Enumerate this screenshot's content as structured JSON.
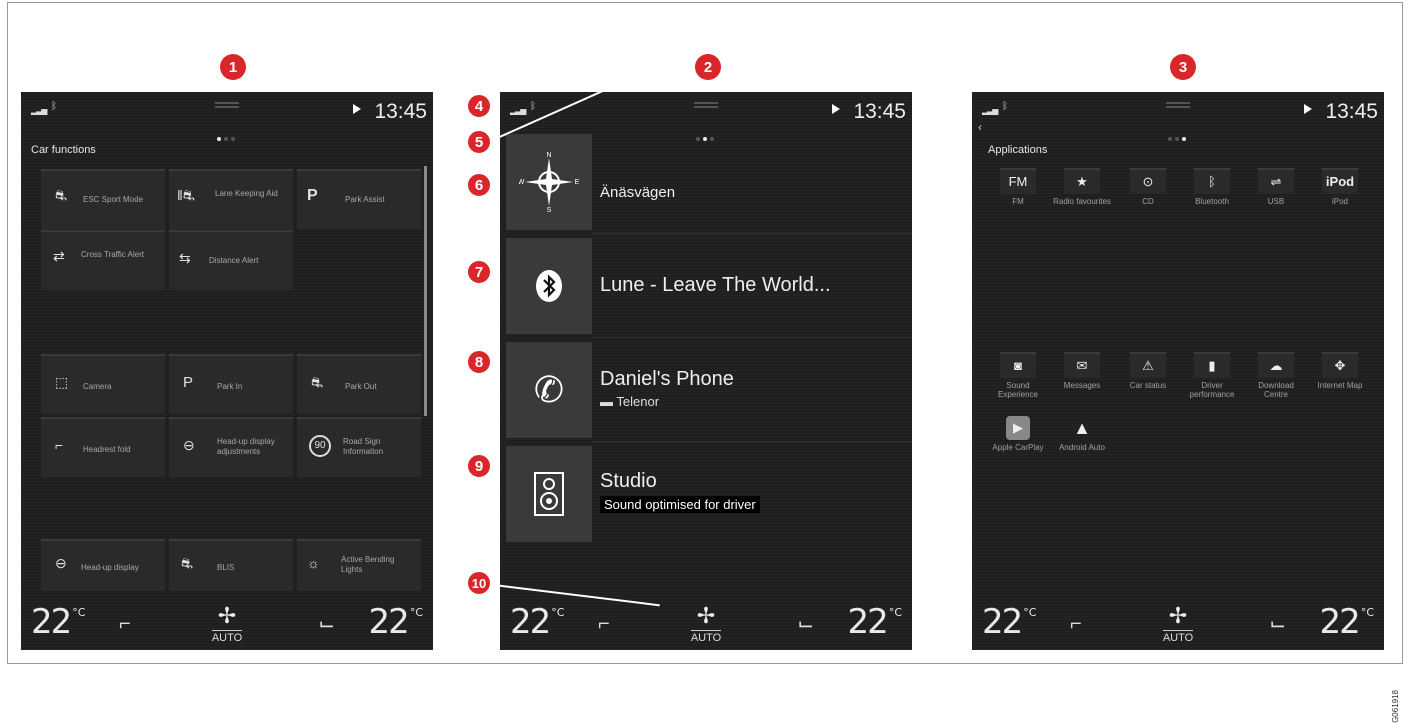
{
  "badges": [
    "1",
    "2",
    "3",
    "4",
    "5",
    "6",
    "7",
    "8",
    "9",
    "10"
  ],
  "screen_status": {
    "clock": "13:45"
  },
  "car_functions": {
    "title": "Car functions",
    "tiles": [
      {
        "icon": "esc-icon",
        "label": "ESC Sport Mode"
      },
      {
        "icon": "lane-keeping-icon",
        "label": "Lane Keeping Aid"
      },
      {
        "icon": "park-assist-icon",
        "label": "Park Assist"
      },
      {
        "icon": "cross-traffic-icon",
        "label": "Cross Traffic Alert"
      },
      {
        "icon": "distance-alert-icon",
        "label": "Distance Alert"
      },
      {
        "icon": "camera-icon",
        "label": "Camera"
      },
      {
        "icon": "park-in-icon",
        "label": "Park In"
      },
      {
        "icon": "park-out-icon",
        "label": "Park Out"
      },
      {
        "icon": "headrest-fold-icon",
        "label": "Headrest fold"
      },
      {
        "icon": "head-up-adjust-icon",
        "label": "Head-up display adjustments"
      },
      {
        "icon": "road-sign-icon",
        "label": "Road Sign Information"
      },
      {
        "icon": "head-up-display-icon",
        "label": "Head-up display"
      },
      {
        "icon": "blis-icon",
        "label": "BLIS"
      },
      {
        "icon": "bending-lights-icon",
        "label": "Active Bending Lights"
      }
    ],
    "glyphs": {
      "park": "P",
      "parkin": "P",
      "road_sign": "90"
    }
  },
  "home": {
    "nav": {
      "icon": "compass-icon",
      "compass": [
        "N",
        "E",
        "S",
        "W"
      ],
      "text": "Änäsvägen"
    },
    "media": {
      "icon": "bluetooth-icon",
      "text": "Lune - Leave The World..."
    },
    "phone": {
      "icon": "phone-icon",
      "text": "Daniel's Phone",
      "sub": "Telenor"
    },
    "audio": {
      "icon": "speaker-icon",
      "text": "Studio",
      "sub": "Sound optimised for driver"
    }
  },
  "applications": {
    "title": "Applications",
    "apps": [
      {
        "icon": "fm-icon",
        "glyph": "FM",
        "label": "FM"
      },
      {
        "icon": "radio-favourites-icon",
        "glyph": "★",
        "label": "Radio favourites"
      },
      {
        "icon": "cd-icon",
        "glyph": "⊙",
        "label": "CD"
      },
      {
        "icon": "bluetooth-icon",
        "glyph": "ᛒ",
        "label": "Bluetooth"
      },
      {
        "icon": "usb-icon",
        "glyph": "⇌",
        "label": "USB"
      },
      {
        "icon": "ipod-icon",
        "glyph": "iPod",
        "label": "iPod"
      },
      {
        "icon": "sound-experience-icon",
        "glyph": "◙",
        "label": "Sound Experience"
      },
      {
        "icon": "messages-icon",
        "glyph": "✉",
        "label": "Messages"
      },
      {
        "icon": "car-status-icon",
        "glyph": "⚠",
        "label": "Car status"
      },
      {
        "icon": "driver-performance-icon",
        "glyph": "▮",
        "label": "Driver performance"
      },
      {
        "icon": "download-centre-icon",
        "glyph": "☁",
        "label": "Download Centre"
      },
      {
        "icon": "internet-map-icon",
        "glyph": "✥",
        "label": "Internet Map"
      },
      {
        "icon": "apple-carplay-icon",
        "glyph": "▶",
        "label": "Apple CarPlay"
      },
      {
        "icon": "android-auto-icon",
        "glyph": "▲",
        "label": "Android Auto"
      }
    ]
  },
  "climate": {
    "left_temp": "22",
    "right_temp": "22",
    "unit": "°C",
    "fan_mode": "AUTO"
  },
  "figure_code": "G061918"
}
